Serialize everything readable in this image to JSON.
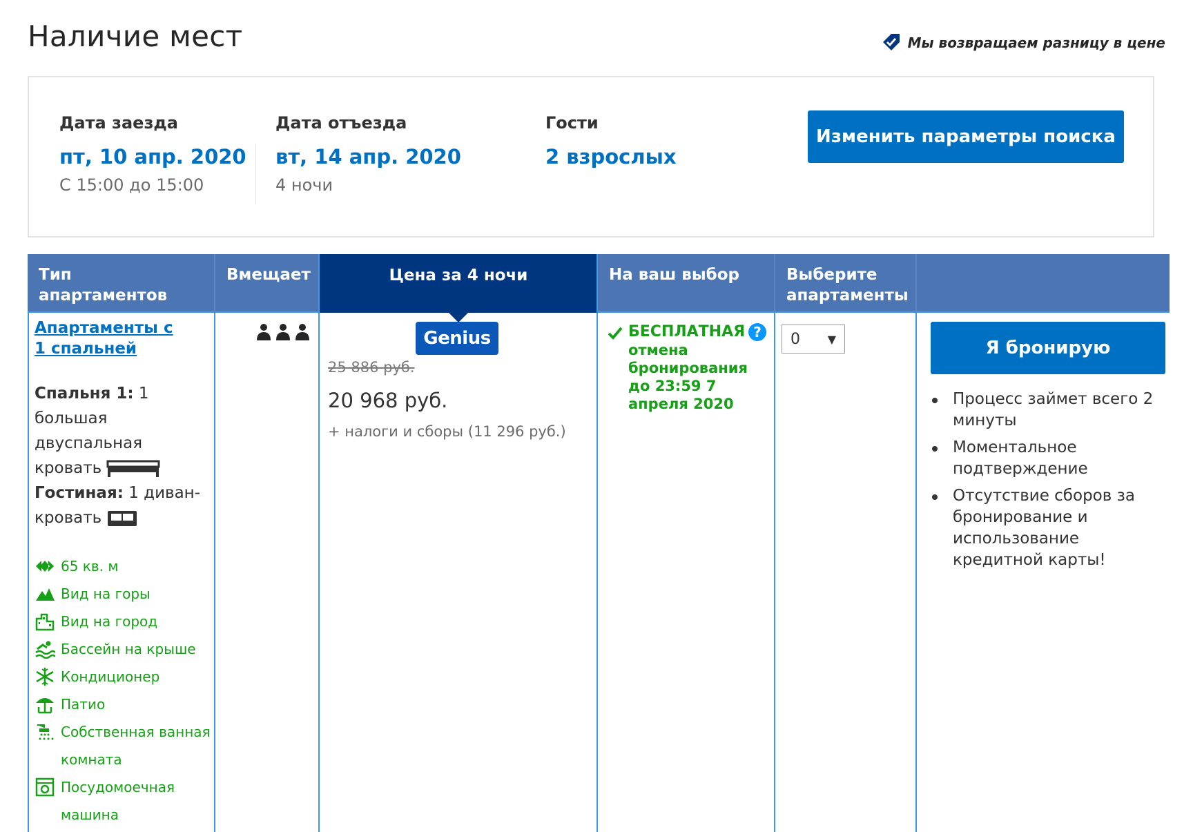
{
  "header": {
    "title": "Наличие мест",
    "price_match": "Мы возвращаем разницу в цене"
  },
  "search": {
    "checkin_label": "Дата заезда",
    "checkin_date": "пт, 10 апр. 2020",
    "checkin_time": "С 15:00 до 15:00",
    "checkout_label": "Дата отъезда",
    "checkout_date": "вт, 14 апр. 2020",
    "nights": "4 ночи",
    "guests_label": "Гости",
    "guests_value": "2 взрослых",
    "change_button": "Изменить параметры поиска"
  },
  "table": {
    "headers": {
      "room_type": "Тип апартаментов",
      "sleeps": "Вмещает",
      "price": "Цена за 4 ночи",
      "choices": "На ваш выбор",
      "select": "Выберите апартаменты"
    },
    "room": {
      "name": "Апартаменты с 1 спальней",
      "bedroom_label": "Спальня 1:",
      "bedroom_value": "1 большая двуспальная кровать",
      "living_label": "Гостиная:",
      "living_value": "1 диван-кровать",
      "occupancy": 3,
      "facilities": [
        {
          "icon": "area-icon",
          "label": "65 кв. м"
        },
        {
          "icon": "mountain-icon",
          "label": "Вид на горы"
        },
        {
          "icon": "city-icon",
          "label": "Вид на город"
        },
        {
          "icon": "pool-icon",
          "label": "Бассейн на крыше"
        },
        {
          "icon": "snowflake-icon",
          "label": "Кондиционер"
        },
        {
          "icon": "umbrella-icon",
          "label": "Патио"
        },
        {
          "icon": "shower-icon",
          "label": "Собственная ванная комната"
        },
        {
          "icon": "dishwasher-icon",
          "label": "Посудомоечная машина"
        }
      ]
    },
    "price": {
      "badge": "Genius",
      "old_price": "25 886 руб.",
      "new_price": "20 968 руб.",
      "taxes": "+ налоги и сборы (11 296 руб.)"
    },
    "cancellation": {
      "title": "БЕСПЛАТНАЯ",
      "text": "отмена бронирования до 23:59 7 апреля 2020",
      "help": "?"
    },
    "select_value": "0",
    "book_button": "Я бронирую",
    "bullets": [
      "Процесс займет всего 2 минуты",
      "Моментальное подтверждение",
      "Отсутствие сборов за бронирование и использование кредитной карты!"
    ]
  },
  "colors": {
    "primary": "#0071c2",
    "header_bg": "#4b76b3",
    "header_active": "#003580",
    "green": "#16a016"
  }
}
